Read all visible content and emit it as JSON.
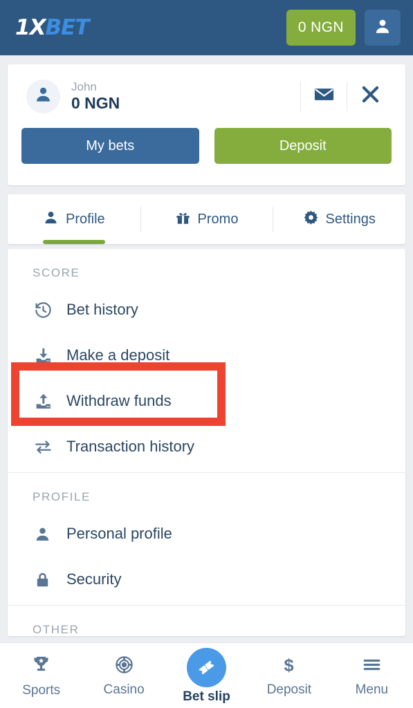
{
  "colors": {
    "header_blue": "#2e5881",
    "accent_green": "#85ad3e",
    "accent_blue": "#3a6b9c",
    "highlight_red": "#ef4331",
    "betslip_blue": "#4a9ae8",
    "page_bg": "#eceef2"
  },
  "header": {
    "logo_part1": "1X",
    "logo_part2": "BET",
    "balance_label": "0 NGN",
    "account_icon": "user-icon"
  },
  "user_card": {
    "avatar_icon": "user-avatar-icon",
    "name": "John",
    "balance": "0 NGN",
    "mail_icon": "envelope-icon",
    "close_icon": "close-icon",
    "my_bets_label": "My bets",
    "deposit_label": "Deposit"
  },
  "tabs": [
    {
      "label": "Profile",
      "icon": "user-icon",
      "active": true
    },
    {
      "label": "Promo",
      "icon": "gift-icon",
      "active": false
    },
    {
      "label": "Settings",
      "icon": "gear-icon",
      "active": false
    }
  ],
  "menu_sections": [
    {
      "title": "SCORE",
      "items": [
        {
          "label": "Bet history",
          "icon": "history-icon"
        },
        {
          "label": "Make a deposit",
          "icon": "download-icon"
        },
        {
          "label": "Withdraw funds",
          "icon": "upload-icon",
          "highlighted": true
        },
        {
          "label": "Transaction history",
          "icon": "transfer-icon"
        }
      ]
    },
    {
      "title": "PROFILE",
      "items": [
        {
          "label": "Personal profile",
          "icon": "user-icon"
        },
        {
          "label": "Security",
          "icon": "lock-icon"
        }
      ]
    },
    {
      "title": "OTHER",
      "items": []
    }
  ],
  "bottom_nav": [
    {
      "label": "Sports",
      "icon": "trophy-icon",
      "active": false
    },
    {
      "label": "Casino",
      "icon": "chip-icon",
      "active": false
    },
    {
      "label": "Bet slip",
      "icon": "ticket-icon",
      "active": true
    },
    {
      "label": "Deposit",
      "icon": "dollar-icon",
      "active": false
    },
    {
      "label": "Menu",
      "icon": "hamburger-icon",
      "active": false
    }
  ]
}
